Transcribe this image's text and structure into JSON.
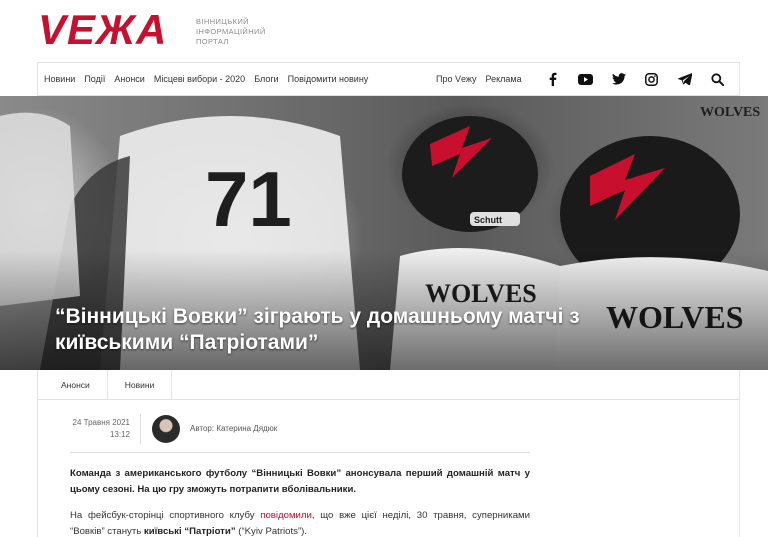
{
  "logo": {
    "word": "VЕЖА",
    "subtitle": "ВІННИЦЬКИЙ ІНФОРМАЦІЙНИЙ ПОРТАЛ"
  },
  "nav": {
    "left": [
      "Новини",
      "Події",
      "Анонси",
      "Місцеві вибори - 2020",
      "Блоги",
      "Повідомити новину"
    ],
    "right": [
      "Про Vежу",
      "Реклама"
    ],
    "icons": [
      "facebook-icon",
      "youtube-icon",
      "twitter-icon",
      "instagram-icon",
      "telegram-icon",
      "search-icon"
    ]
  },
  "colors": {
    "brand": "#c8102e"
  },
  "article": {
    "title": "“Вінницькі Вовки” зіграють у домашньому матчі з київськими “Патріотами”",
    "tags": [
      "Анонси",
      "Новини"
    ],
    "date": "24 Травня 2021",
    "time": "13:12",
    "author": "Автор: Катерина Дядюк",
    "lead": "Команда з американського футболу “Вінницькі Вовки” анонсувала перший домашній матч у цьому сезоні. На цю гру зможуть потрапити вболівальники.",
    "para_start": "На фейсбук-сторінці спортивного клубу ",
    "para_link": "повідомили",
    "para_mid": ", що вже цієї неділі, 30 травня, суперниками “Вовків” стануть ",
    "para_bold": "київські “Патріоти”",
    "para_end": " (“Kyiv Patriots”)."
  },
  "hero_text": {
    "jersey_number": "71",
    "jersey_name": "WOLVES",
    "helmet_brand": "Schutt"
  }
}
